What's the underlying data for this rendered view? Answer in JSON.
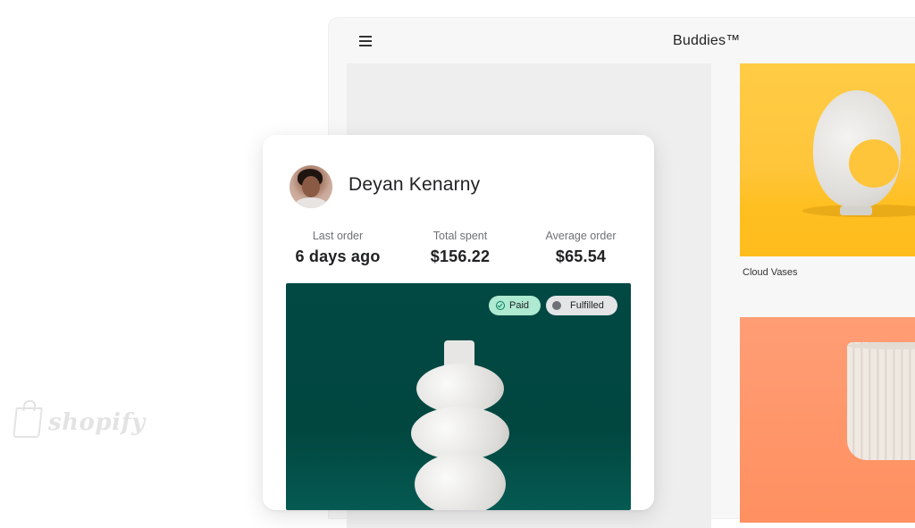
{
  "store": {
    "title": "Buddies™",
    "menu_icon": "hamburger-menu-icon",
    "products": [
      {
        "name": "Cloud Vases"
      },
      {
        "name": ""
      }
    ]
  },
  "customer": {
    "name": "Deyan Kenarny",
    "stats": [
      {
        "label": "Last order",
        "value": "6 days ago"
      },
      {
        "label": "Total spent",
        "value": "$156.22"
      },
      {
        "label": "Average order",
        "value": "$65.54"
      }
    ],
    "badges": {
      "paid": "Paid",
      "fulfilled": "Fulfilled"
    }
  },
  "brand": {
    "wordmark": "shopify"
  },
  "colors": {
    "paid_badge": "#aee9d1",
    "fulfilled_badge": "#e4e5e7",
    "order_image_bg": "#024843",
    "product1_bg": "#ffc53a",
    "product2_bg": "#ff9a6c"
  }
}
